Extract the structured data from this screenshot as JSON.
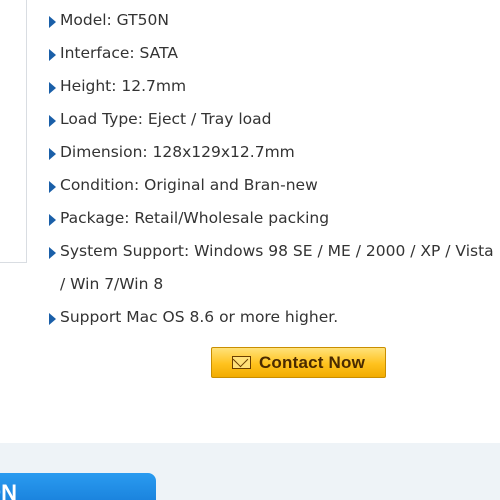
{
  "specs": [
    "Model: GT50N",
    "Interface: SATA",
    "Height: 12.7mm",
    "Load Type: Eject / Tray load",
    "Dimension: 128x129x12.7mm",
    "Condition: Original and Bran-new",
    "Package: Retail/Wholesale packing",
    "System Support: Windows 98 SE / ME / 2000 / XP / Vista / Win 7/Win 8",
    "Support Mac OS 8.6 or more higher."
  ],
  "contact_button": {
    "label": "Contact Now",
    "icon": "envelope-icon"
  },
  "bottom_tab": {
    "label": "ON"
  },
  "colors": {
    "arrow": "#1a5fa8",
    "text": "#333333",
    "button_gold": "#ffc21e",
    "tab_blue": "#1479d6",
    "band": "#eef3f7"
  }
}
